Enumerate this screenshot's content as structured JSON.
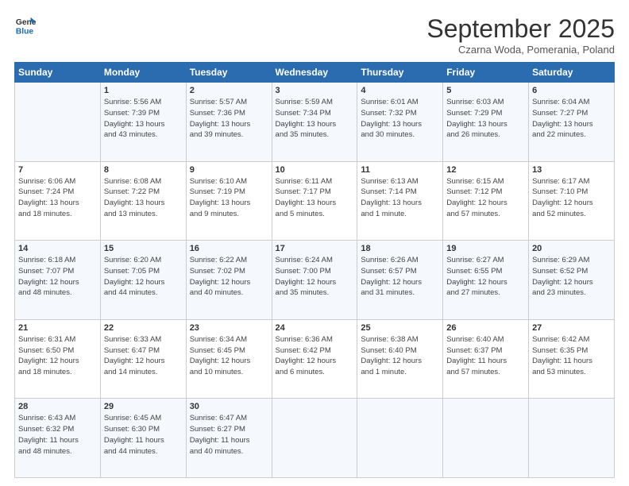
{
  "logo": {
    "line1": "General",
    "line2": "Blue"
  },
  "header": {
    "title": "September 2025",
    "subtitle": "Czarna Woda, Pomerania, Poland"
  },
  "days": [
    "Sunday",
    "Monday",
    "Tuesday",
    "Wednesday",
    "Thursday",
    "Friday",
    "Saturday"
  ],
  "weeks": [
    [
      {
        "day": "",
        "text": ""
      },
      {
        "day": "1",
        "text": "Sunrise: 5:56 AM\nSunset: 7:39 PM\nDaylight: 13 hours\nand 43 minutes."
      },
      {
        "day": "2",
        "text": "Sunrise: 5:57 AM\nSunset: 7:36 PM\nDaylight: 13 hours\nand 39 minutes."
      },
      {
        "day": "3",
        "text": "Sunrise: 5:59 AM\nSunset: 7:34 PM\nDaylight: 13 hours\nand 35 minutes."
      },
      {
        "day": "4",
        "text": "Sunrise: 6:01 AM\nSunset: 7:32 PM\nDaylight: 13 hours\nand 30 minutes."
      },
      {
        "day": "5",
        "text": "Sunrise: 6:03 AM\nSunset: 7:29 PM\nDaylight: 13 hours\nand 26 minutes."
      },
      {
        "day": "6",
        "text": "Sunrise: 6:04 AM\nSunset: 7:27 PM\nDaylight: 13 hours\nand 22 minutes."
      }
    ],
    [
      {
        "day": "7",
        "text": "Sunrise: 6:06 AM\nSunset: 7:24 PM\nDaylight: 13 hours\nand 18 minutes."
      },
      {
        "day": "8",
        "text": "Sunrise: 6:08 AM\nSunset: 7:22 PM\nDaylight: 13 hours\nand 13 minutes."
      },
      {
        "day": "9",
        "text": "Sunrise: 6:10 AM\nSunset: 7:19 PM\nDaylight: 13 hours\nand 9 minutes."
      },
      {
        "day": "10",
        "text": "Sunrise: 6:11 AM\nSunset: 7:17 PM\nDaylight: 13 hours\nand 5 minutes."
      },
      {
        "day": "11",
        "text": "Sunrise: 6:13 AM\nSunset: 7:14 PM\nDaylight: 13 hours\nand 1 minute."
      },
      {
        "day": "12",
        "text": "Sunrise: 6:15 AM\nSunset: 7:12 PM\nDaylight: 12 hours\nand 57 minutes."
      },
      {
        "day": "13",
        "text": "Sunrise: 6:17 AM\nSunset: 7:10 PM\nDaylight: 12 hours\nand 52 minutes."
      }
    ],
    [
      {
        "day": "14",
        "text": "Sunrise: 6:18 AM\nSunset: 7:07 PM\nDaylight: 12 hours\nand 48 minutes."
      },
      {
        "day": "15",
        "text": "Sunrise: 6:20 AM\nSunset: 7:05 PM\nDaylight: 12 hours\nand 44 minutes."
      },
      {
        "day": "16",
        "text": "Sunrise: 6:22 AM\nSunset: 7:02 PM\nDaylight: 12 hours\nand 40 minutes."
      },
      {
        "day": "17",
        "text": "Sunrise: 6:24 AM\nSunset: 7:00 PM\nDaylight: 12 hours\nand 35 minutes."
      },
      {
        "day": "18",
        "text": "Sunrise: 6:26 AM\nSunset: 6:57 PM\nDaylight: 12 hours\nand 31 minutes."
      },
      {
        "day": "19",
        "text": "Sunrise: 6:27 AM\nSunset: 6:55 PM\nDaylight: 12 hours\nand 27 minutes."
      },
      {
        "day": "20",
        "text": "Sunrise: 6:29 AM\nSunset: 6:52 PM\nDaylight: 12 hours\nand 23 minutes."
      }
    ],
    [
      {
        "day": "21",
        "text": "Sunrise: 6:31 AM\nSunset: 6:50 PM\nDaylight: 12 hours\nand 18 minutes."
      },
      {
        "day": "22",
        "text": "Sunrise: 6:33 AM\nSunset: 6:47 PM\nDaylight: 12 hours\nand 14 minutes."
      },
      {
        "day": "23",
        "text": "Sunrise: 6:34 AM\nSunset: 6:45 PM\nDaylight: 12 hours\nand 10 minutes."
      },
      {
        "day": "24",
        "text": "Sunrise: 6:36 AM\nSunset: 6:42 PM\nDaylight: 12 hours\nand 6 minutes."
      },
      {
        "day": "25",
        "text": "Sunrise: 6:38 AM\nSunset: 6:40 PM\nDaylight: 12 hours\nand 1 minute."
      },
      {
        "day": "26",
        "text": "Sunrise: 6:40 AM\nSunset: 6:37 PM\nDaylight: 11 hours\nand 57 minutes."
      },
      {
        "day": "27",
        "text": "Sunrise: 6:42 AM\nSunset: 6:35 PM\nDaylight: 11 hours\nand 53 minutes."
      }
    ],
    [
      {
        "day": "28",
        "text": "Sunrise: 6:43 AM\nSunset: 6:32 PM\nDaylight: 11 hours\nand 48 minutes."
      },
      {
        "day": "29",
        "text": "Sunrise: 6:45 AM\nSunset: 6:30 PM\nDaylight: 11 hours\nand 44 minutes."
      },
      {
        "day": "30",
        "text": "Sunrise: 6:47 AM\nSunset: 6:27 PM\nDaylight: 11 hours\nand 40 minutes."
      },
      {
        "day": "",
        "text": ""
      },
      {
        "day": "",
        "text": ""
      },
      {
        "day": "",
        "text": ""
      },
      {
        "day": "",
        "text": ""
      }
    ]
  ]
}
